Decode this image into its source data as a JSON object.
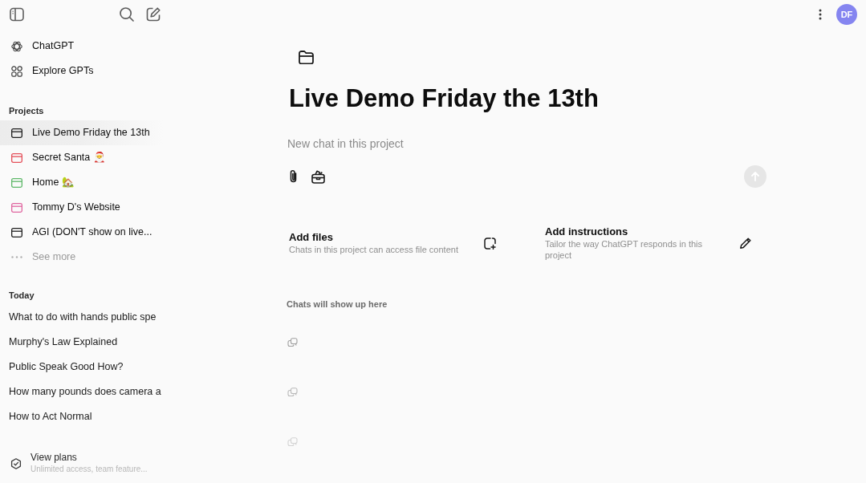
{
  "sidebar": {
    "nav": [
      {
        "label": "ChatGPT",
        "kind": "logo"
      },
      {
        "label": "Explore GPTs",
        "kind": "grid"
      }
    ],
    "projects_heading": "Projects",
    "projects": [
      {
        "label": "Live Demo Friday the 13th",
        "color": "#1f1f1f",
        "selected": true
      },
      {
        "label": "Secret Santa 🎅",
        "color": "#e5505a",
        "selected": false
      },
      {
        "label": "Home 🏡",
        "color": "#5fb86a",
        "selected": false
      },
      {
        "label": "Tommy D's Website",
        "color": "#e066a0",
        "selected": false
      },
      {
        "label": "AGI (DON'T show on live...",
        "color": "#1f1f1f",
        "selected": false
      }
    ],
    "see_more": "See more",
    "today_heading": "Today",
    "chats": [
      "What to do with hands public spe",
      "Murphy's Law Explained",
      "Public Speak Good How?",
      "How many pounds does camera a",
      "How to Act Normal"
    ],
    "upgrade": {
      "title": "View plans",
      "subtitle": "Unlimited access, team feature..."
    }
  },
  "header": {
    "avatar": "DF"
  },
  "project": {
    "title": "Live Demo Friday the 13th",
    "composer": {
      "placeholder": "New chat in this project",
      "send_button": {
        "disabled": true
      }
    },
    "cards": [
      {
        "kind": "files",
        "title": "Add files",
        "description": "Chats in this project can access file content"
      },
      {
        "kind": "instructions",
        "title": "Add instructions",
        "description": "Tailor the way ChatGPT responds in this project"
      }
    ],
    "empty_label": "Chats will show up here"
  }
}
